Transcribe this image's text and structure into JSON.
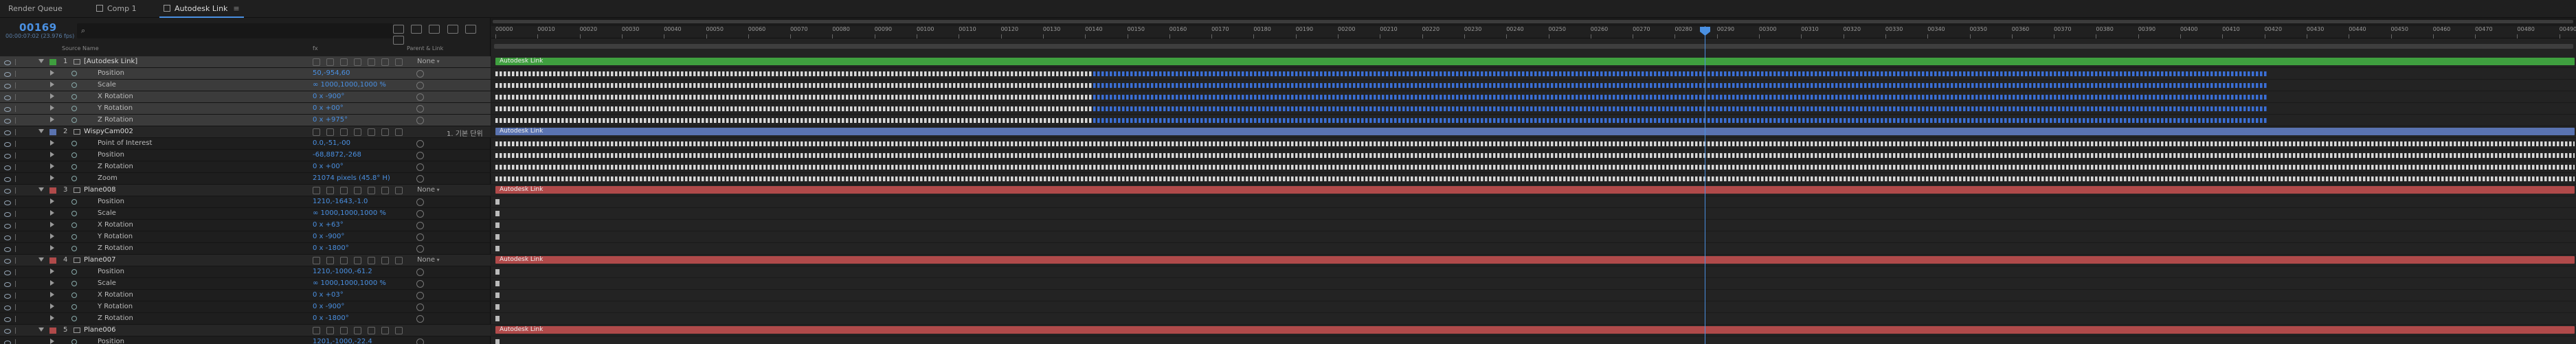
{
  "tabs": [
    {
      "label": "Render Queue",
      "active": false,
      "icon": "menu-icon"
    },
    {
      "label": "Comp 1",
      "active": false,
      "icon": "composition-icon"
    },
    {
      "label": "Autodesk Link",
      "active": true,
      "icon": "composition-icon"
    }
  ],
  "timecode": "00169",
  "fps": "00:00:07:02 (23.976 fps)",
  "columns": {
    "source_name": "Source Name",
    "switches": "fx",
    "parent": "Parent & Link"
  },
  "rows": [
    {
      "type": "layer",
      "num": "1",
      "name": "[Autodesk Link]",
      "color": "#3f9f3f",
      "selected": true,
      "link": "None",
      "parent": ""
    },
    {
      "type": "prop",
      "name": "Position",
      "value": "50,-954,60",
      "selected": true
    },
    {
      "type": "prop",
      "name": "Scale",
      "value": "∞ 1000,1000,1000 %",
      "selected": true
    },
    {
      "type": "prop",
      "name": "X Rotation",
      "value": "0 x -900°",
      "selected": true
    },
    {
      "type": "prop",
      "name": "Y Rotation",
      "value": "0 x +00°",
      "selected": true
    },
    {
      "type": "prop",
      "name": "Z Rotation",
      "value": "0 x +975°",
      "selected": true
    },
    {
      "type": "layer",
      "num": "2",
      "name": "WispyCam002",
      "color": "#5a73b0",
      "selected": false,
      "link": "",
      "parent": "1. 기본 단위"
    },
    {
      "type": "prop",
      "name": "Point of Interest",
      "value": "0.0,-51,-00",
      "selected": false
    },
    {
      "type": "prop",
      "name": "Position",
      "value": "-68,8872,-268",
      "selected": false
    },
    {
      "type": "prop",
      "name": "Z Rotation",
      "value": "0 x +00°",
      "selected": false
    },
    {
      "type": "prop",
      "name": "Zoom",
      "value": "21074 pixels (45.8° H)",
      "selected": false
    },
    {
      "type": "layer",
      "num": "3",
      "name": "Plane008",
      "color": "#b04a4a",
      "selected": false,
      "link": "None",
      "parent": ""
    },
    {
      "type": "prop",
      "name": "Position",
      "value": "1210,-1643,-1.0",
      "selected": false
    },
    {
      "type": "prop",
      "name": "Scale",
      "value": "∞ 1000,1000,1000 %",
      "selected": false
    },
    {
      "type": "prop",
      "name": "X Rotation",
      "value": "0 x +63°",
      "selected": false
    },
    {
      "type": "prop",
      "name": "Y Rotation",
      "value": "0 x -900°",
      "selected": false
    },
    {
      "type": "prop",
      "name": "Z Rotation",
      "value": "0 x -1800°",
      "selected": false
    },
    {
      "type": "layer",
      "num": "4",
      "name": "Plane007",
      "color": "#b04a4a",
      "selected": false,
      "link": "None",
      "parent": ""
    },
    {
      "type": "prop",
      "name": "Position",
      "value": "1210,-1000,-61.2",
      "selected": false
    },
    {
      "type": "prop",
      "name": "Scale",
      "value": "∞ 1000,1000,1000 %",
      "selected": false
    },
    {
      "type": "prop",
      "name": "X Rotation",
      "value": "0 x +03°",
      "selected": false
    },
    {
      "type": "prop",
      "name": "Y Rotation",
      "value": "0 x -900°",
      "selected": false
    },
    {
      "type": "prop",
      "name": "Z Rotation",
      "value": "0 x -1800°",
      "selected": false
    },
    {
      "type": "layer",
      "num": "5",
      "name": "Plane006",
      "color": "#b04a4a",
      "selected": false,
      "link": "",
      "parent": ""
    },
    {
      "type": "prop",
      "name": "Position",
      "value": "1201,-1000,-22.4",
      "selected": false
    }
  ],
  "ruler_ticks": [
    "00000",
    "00010",
    "00020",
    "00030",
    "00040",
    "00050",
    "00060",
    "00070",
    "00080",
    "00090",
    "00100",
    "00110",
    "00120",
    "00130",
    "00140",
    "00150",
    "00160",
    "00170",
    "00180",
    "00190",
    "00200",
    "00210",
    "00220",
    "00230",
    "00240",
    "00250",
    "00260",
    "00270",
    "00280",
    "00290",
    "00300",
    "00310",
    "00320",
    "00330",
    "00340",
    "00350",
    "00360",
    "00370",
    "00380",
    "00390",
    "00400",
    "00410",
    "00420",
    "00430",
    "00440",
    "00450",
    "00460",
    "00470",
    "00480",
    "00490"
  ],
  "clip_label": "Autodesk Link",
  "colors": {
    "accent": "#4a90e2",
    "green": "#3f9f3f",
    "blue": "#5a73b0",
    "red": "#b04a4a"
  }
}
